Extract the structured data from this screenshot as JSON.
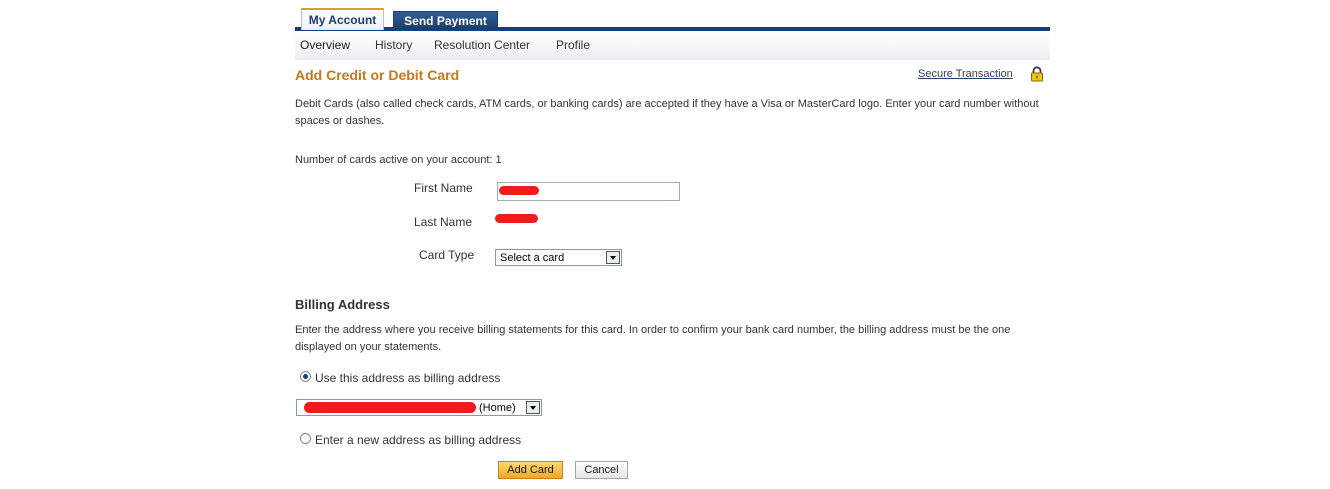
{
  "tabs": {
    "my_account": "My Account",
    "send_payment": "Send Payment"
  },
  "subnav": {
    "overview": "Overview",
    "history": "History",
    "resolution_center": "Resolution Center",
    "profile": "Profile"
  },
  "header": {
    "title": "Add Credit or Debit Card",
    "secure_link": "Secure Transaction",
    "secure_icon": "padlock-icon"
  },
  "intro": "Debit Cards (also called check cards, ATM cards, or banking cards) are accepted if they have a Visa or MasterCard logo. Enter your card number without spaces or dashes.",
  "cards_active": "Number of cards active on your account: 1",
  "form": {
    "first_name_label": "First Name",
    "last_name_label": "Last Name",
    "card_type_label": "Card Type",
    "card_type_selected": "Select a card"
  },
  "billing": {
    "title": "Billing Address",
    "description": "Enter the address where you receive billing statements for this card. In order to confirm your bank card number, the billing address must be the one displayed on your statements.",
    "use_existing_label": "Use this address as billing address",
    "address_suffix": "(Home)",
    "new_address_label": "Enter a new address as billing address"
  },
  "buttons": {
    "add_card": "Add Card",
    "cancel": "Cancel"
  },
  "colors": {
    "title_orange": "#c4791c",
    "nav_blue": "#163f74",
    "redaction_red": "#ee1c1c",
    "primary_button": "#f5a623"
  }
}
